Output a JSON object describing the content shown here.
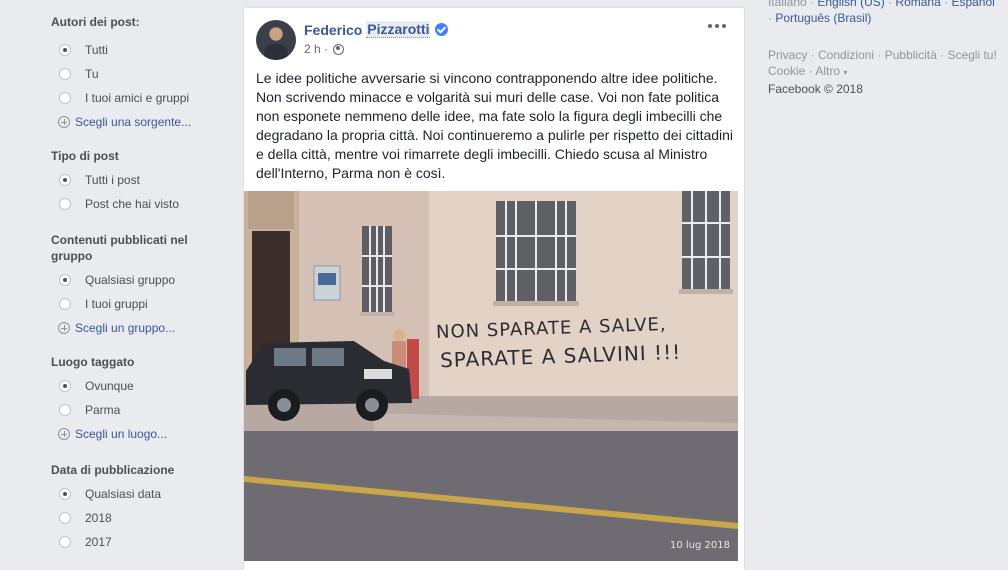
{
  "filters": {
    "authors": {
      "title": "Autori dei post",
      "options": [
        "Tutti",
        "Tu",
        "I tuoi amici e gruppi"
      ],
      "selected": 0,
      "pick": "Scegli una sorgente..."
    },
    "post_type": {
      "title": "Tipo di post",
      "options": [
        "Tutti i post",
        "Post che hai visto"
      ],
      "selected": 0
    },
    "group_content": {
      "title": "Contenuti pubblicati nel gruppo",
      "options": [
        "Qualsiasi gruppo",
        "I tuoi gruppi"
      ],
      "selected": 0,
      "pick": "Scegli un gruppo..."
    },
    "tagged_location": {
      "title": "Luogo taggato",
      "options": [
        "Ovunque",
        "Parma"
      ],
      "selected": 0,
      "pick": "Scegli un luogo..."
    },
    "date": {
      "title": "Data di pubblicazione",
      "options": [
        "Qualsiasi data",
        "2018",
        "2017"
      ],
      "selected": 0
    }
  },
  "post": {
    "author_first": "Federico",
    "author_last": "Pizzarotti",
    "time": "2 h",
    "separator": "·",
    "text": "Le idee politiche avversarie si vincono contrapponendo altre idee politiche. Non scrivendo minacce e volgarità sui muri delle case. Voi non fate politica non esponete nemmeno delle idee, ma fate solo la figura degli imbecilli che degradano la propria città. Noi continueremo a pulirle per rispetto dei cittadini e della città, mentre voi rimarrete degli imbecilli. Chiedo scusa al Ministro dell'Interno, Parma non è così.",
    "photo": {
      "graffiti_line1": "NON SPARATE A SALVE,",
      "graffiti_line2": "SPARATE A SALVINI !!!",
      "date_stamp": "10 lug 2018"
    }
  },
  "right": {
    "langs_line1": [
      "Italiano",
      "English (US)",
      "Română",
      "Español"
    ],
    "langs_line2": "Português (Brasil)",
    "links": [
      "Privacy",
      "Condizioni",
      "Pubblicità",
      "Scegli tu!",
      "Cookie",
      "Altro"
    ],
    "copyright": "Facebook © 2018"
  },
  "colors": {
    "link": "#385898",
    "background": "#e9ebee",
    "verified": "#4080ff"
  }
}
